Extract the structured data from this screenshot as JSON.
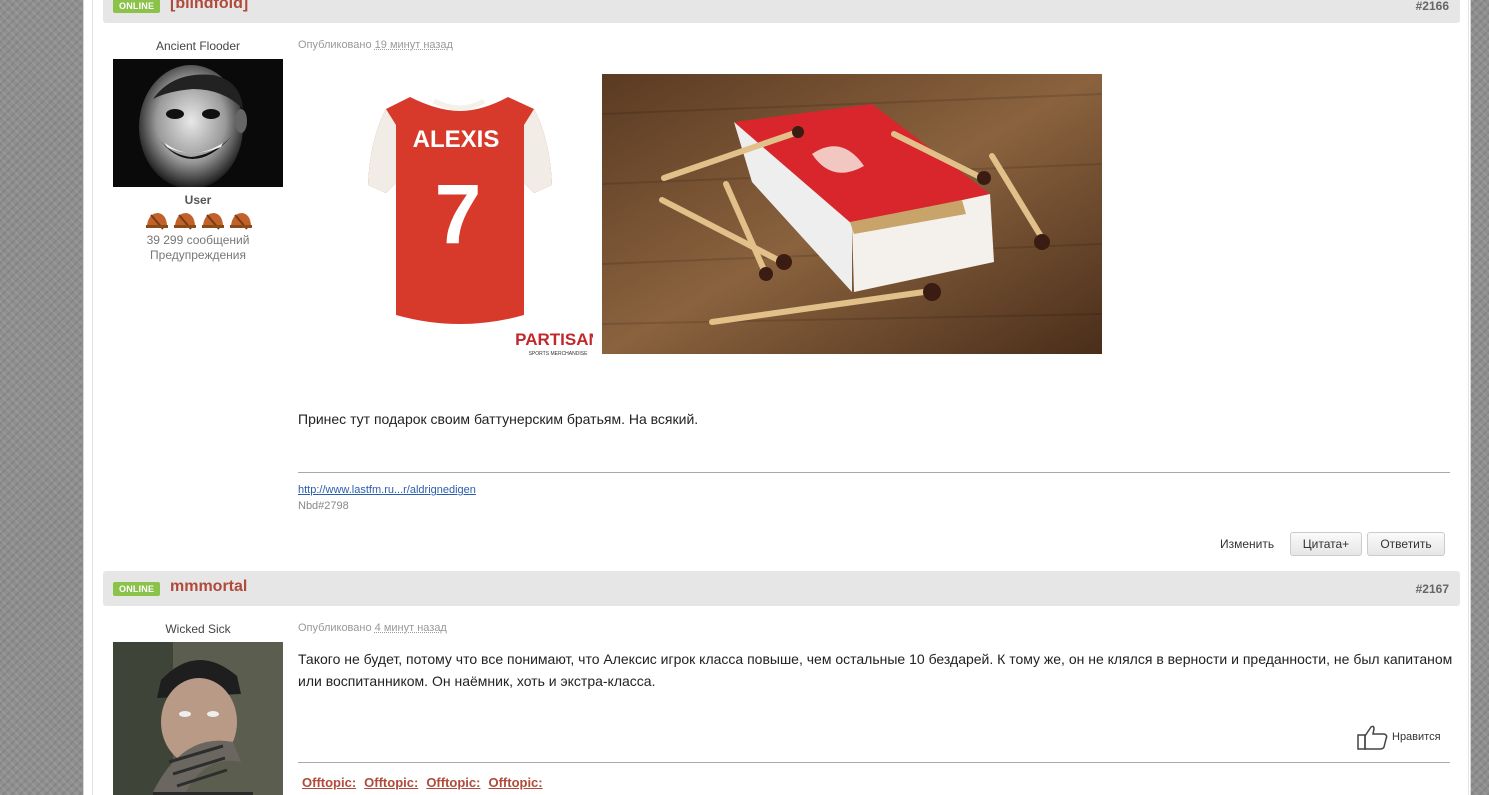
{
  "posts": [
    {
      "status_badge": "ONLINE",
      "author": "[blindfold]",
      "number": "#2166",
      "user_title": "Ancient Flooder",
      "group": "User",
      "message_count": "39 299 сообщений",
      "warnings": "Предупреждения",
      "published_prefix": "Опубликовано",
      "published_time": "19 минут назад",
      "text": "Принес тут подарок своим баттунерским братьям. На всякий.",
      "jersey": {
        "name": "ALEXIS",
        "number": "7",
        "brand": "PARTISAN",
        "brand_sub": "SPORTS MERCHANDISE"
      },
      "signature_link": "http://www.lastfm.ru...r/aldrignedigen",
      "signature_text": "Nbd#2798",
      "actions": {
        "edit": "Изменить",
        "quote": "Цитата+",
        "reply": "Ответить"
      }
    },
    {
      "status_badge": "ONLINE",
      "author": "mmmortal",
      "number": "#2167",
      "user_title": "Wicked Sick",
      "published_prefix": "Опубликовано",
      "published_time": "4 минут назад",
      "text": "Такого не будет, потому что все понимают, что Алексис игрок класса повыше, чем остальные 10 бездарей. К тому же, он не клялся в верности и преданности, не был капитаном или воспитанником. Он наёмник, хоть и экстра-класса.",
      "like_label": "Нравится",
      "signature_tags": [
        "Offtopic:",
        "Offtopic:",
        "Offtopic:",
        "Offtopic:"
      ]
    }
  ],
  "colors": {
    "accent": "#b04a3a",
    "online": "#8bc24a",
    "link": "#2a5db0"
  }
}
